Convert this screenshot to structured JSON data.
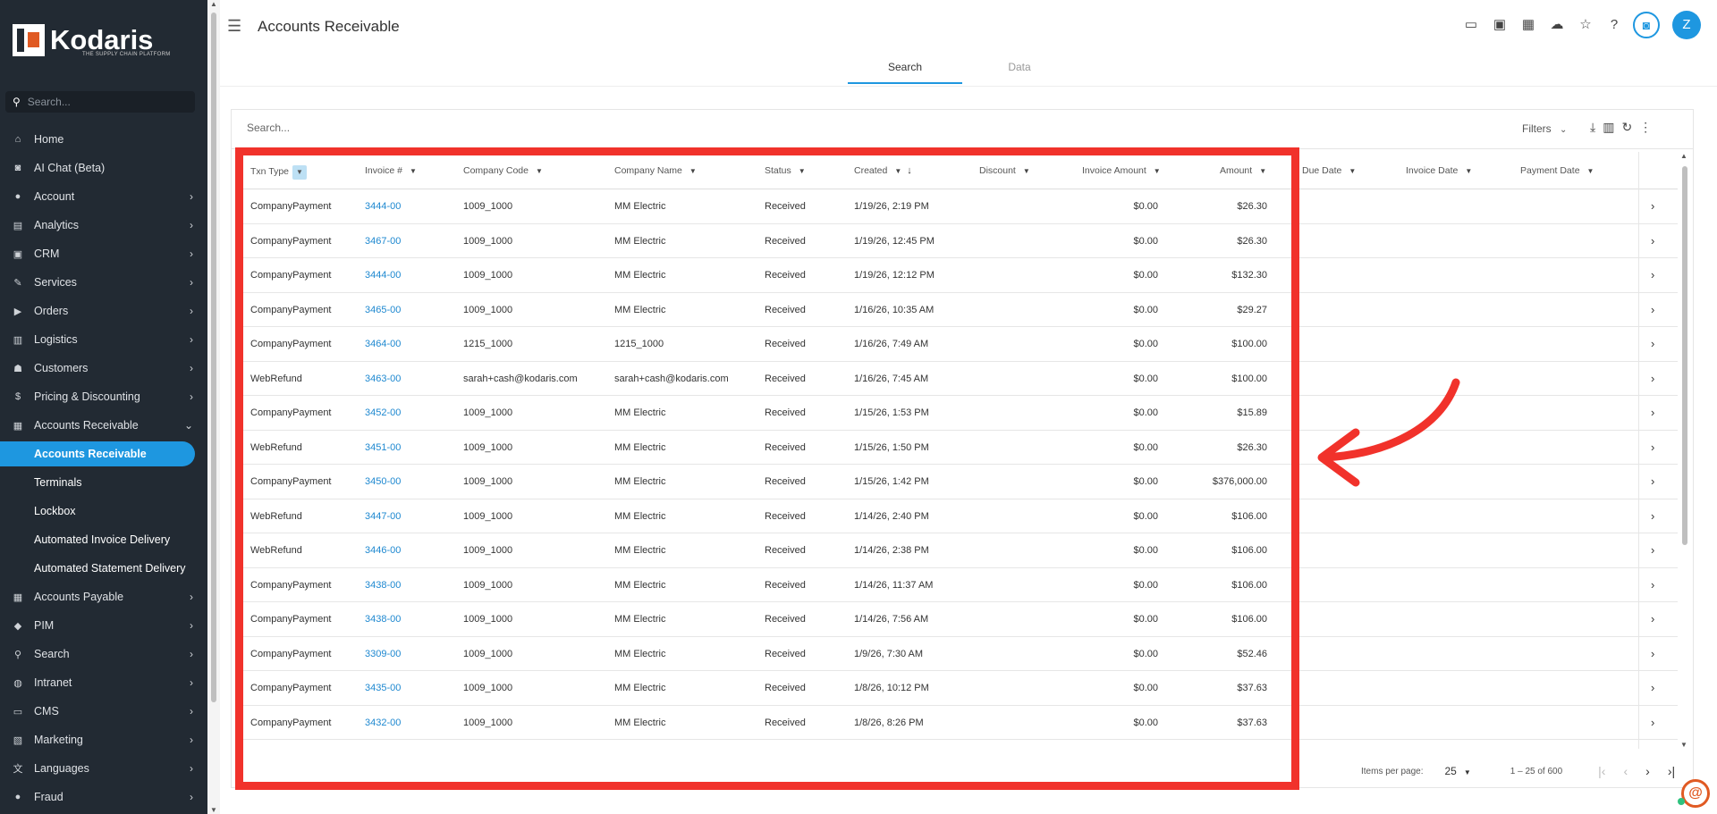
{
  "sidebar": {
    "brand": "Kodaris",
    "tagline": "THE SUPPLY CHAIN PLATFORM",
    "search_placeholder": "Search...",
    "items": [
      {
        "label": "Home",
        "icon": "home-icon",
        "glyph": "⌂"
      },
      {
        "label": "AI Chat (Beta)",
        "icon": "robot-icon",
        "glyph": "◙"
      },
      {
        "label": "Account",
        "icon": "person-icon",
        "glyph": "●"
      },
      {
        "label": "Analytics",
        "icon": "chart-icon",
        "glyph": "▤"
      },
      {
        "label": "CRM",
        "icon": "contact-card-icon",
        "glyph": "▣"
      },
      {
        "label": "Services",
        "icon": "services-icon",
        "glyph": "✎"
      },
      {
        "label": "Orders",
        "icon": "truck-icon",
        "glyph": "▶"
      },
      {
        "label": "Logistics",
        "icon": "box-icon",
        "glyph": "▥"
      },
      {
        "label": "Customers",
        "icon": "people-icon",
        "glyph": "☗"
      },
      {
        "label": "Pricing & Discounting",
        "icon": "dollar-icon",
        "glyph": "$"
      },
      {
        "label": "Accounts Receivable",
        "icon": "bank-icon",
        "glyph": "▦"
      }
    ],
    "sub_items": [
      {
        "label": "Accounts Receivable"
      },
      {
        "label": "Terminals"
      },
      {
        "label": "Lockbox"
      },
      {
        "label": "Automated Invoice Delivery"
      },
      {
        "label": "Automated Statement Delivery"
      }
    ],
    "items_after": [
      {
        "label": "Accounts Payable",
        "icon": "bank-icon",
        "glyph": "▦"
      },
      {
        "label": "PIM",
        "icon": "tag-icon",
        "glyph": "◆"
      },
      {
        "label": "Search",
        "icon": "search-icon",
        "glyph": "⚲"
      },
      {
        "label": "Intranet",
        "icon": "globe-icon",
        "glyph": "◍"
      },
      {
        "label": "CMS",
        "icon": "window-icon",
        "glyph": "▭"
      },
      {
        "label": "Marketing",
        "icon": "newspaper-icon",
        "glyph": "▧"
      },
      {
        "label": "Languages",
        "icon": "translate-icon",
        "glyph": "文"
      },
      {
        "label": "Fraud",
        "icon": "alert-icon",
        "glyph": "●"
      }
    ]
  },
  "header": {
    "title": "Accounts Receivable",
    "user_initial": "Z"
  },
  "tabs": [
    {
      "label": "Search"
    },
    {
      "label": "Data"
    }
  ],
  "table": {
    "search_placeholder": "Search...",
    "filters_label": "Filters",
    "columns": {
      "txn_type": "Txn Type",
      "invoice": "Invoice #",
      "company_code": "Company Code",
      "company_name": "Company Name",
      "status": "Status",
      "created": "Created",
      "discount": "Discount",
      "invoice_amount": "Invoice Amount",
      "amount": "Amount",
      "due_date": "Due Date",
      "invoice_date": "Invoice Date",
      "payment_date": "Payment Date"
    },
    "rows": [
      {
        "txn": "CompanyPayment",
        "inv": "3444-00",
        "code": "1009_1000",
        "name": "MM Electric",
        "status": "Received",
        "created": "1/19/26, 2:19 PM",
        "inv_amt": "$0.00",
        "amt": "$26.30"
      },
      {
        "txn": "CompanyPayment",
        "inv": "3467-00",
        "code": "1009_1000",
        "name": "MM Electric",
        "status": "Received",
        "created": "1/19/26, 12:45 PM",
        "inv_amt": "$0.00",
        "amt": "$26.30"
      },
      {
        "txn": "CompanyPayment",
        "inv": "3444-00",
        "code": "1009_1000",
        "name": "MM Electric",
        "status": "Received",
        "created": "1/19/26, 12:12 PM",
        "inv_amt": "$0.00",
        "amt": "$132.30"
      },
      {
        "txn": "CompanyPayment",
        "inv": "3465-00",
        "code": "1009_1000",
        "name": "MM Electric",
        "status": "Received",
        "created": "1/16/26, 10:35 AM",
        "inv_amt": "$0.00",
        "amt": "$29.27"
      },
      {
        "txn": "CompanyPayment",
        "inv": "3464-00",
        "code": "1215_1000",
        "name": "1215_1000",
        "status": "Received",
        "created": "1/16/26, 7:49 AM",
        "inv_amt": "$0.00",
        "amt": "$100.00"
      },
      {
        "txn": "WebRefund",
        "inv": "3463-00",
        "code": "sarah+cash@kodaris.com",
        "name": "sarah+cash@kodaris.com",
        "status": "Received",
        "created": "1/16/26, 7:45 AM",
        "inv_amt": "$0.00",
        "amt": "$100.00"
      },
      {
        "txn": "CompanyPayment",
        "inv": "3452-00",
        "code": "1009_1000",
        "name": "MM Electric",
        "status": "Received",
        "created": "1/15/26, 1:53 PM",
        "inv_amt": "$0.00",
        "amt": "$15.89"
      },
      {
        "txn": "WebRefund",
        "inv": "3451-00",
        "code": "1009_1000",
        "name": "MM Electric",
        "status": "Received",
        "created": "1/15/26, 1:50 PM",
        "inv_amt": "$0.00",
        "amt": "$26.30"
      },
      {
        "txn": "CompanyPayment",
        "inv": "3450-00",
        "code": "1009_1000",
        "name": "MM Electric",
        "status": "Received",
        "created": "1/15/26, 1:42 PM",
        "inv_amt": "$0.00",
        "amt": "$376,000.00"
      },
      {
        "txn": "WebRefund",
        "inv": "3447-00",
        "code": "1009_1000",
        "name": "MM Electric",
        "status": "Received",
        "created": "1/14/26, 2:40 PM",
        "inv_amt": "$0.00",
        "amt": "$106.00"
      },
      {
        "txn": "WebRefund",
        "inv": "3446-00",
        "code": "1009_1000",
        "name": "MM Electric",
        "status": "Received",
        "created": "1/14/26, 2:38 PM",
        "inv_amt": "$0.00",
        "amt": "$106.00"
      },
      {
        "txn": "CompanyPayment",
        "inv": "3438-00",
        "code": "1009_1000",
        "name": "MM Electric",
        "status": "Received",
        "created": "1/14/26, 11:37 AM",
        "inv_amt": "$0.00",
        "amt": "$106.00"
      },
      {
        "txn": "CompanyPayment",
        "inv": "3438-00",
        "code": "1009_1000",
        "name": "MM Electric",
        "status": "Received",
        "created": "1/14/26, 7:56 AM",
        "inv_amt": "$0.00",
        "amt": "$106.00"
      },
      {
        "txn": "CompanyPayment",
        "inv": "3309-00",
        "code": "1009_1000",
        "name": "MM Electric",
        "status": "Received",
        "created": "1/9/26, 7:30 AM",
        "inv_amt": "$0.00",
        "amt": "$52.46"
      },
      {
        "txn": "CompanyPayment",
        "inv": "3435-00",
        "code": "1009_1000",
        "name": "MM Electric",
        "status": "Received",
        "created": "1/8/26, 10:12 PM",
        "inv_amt": "$0.00",
        "amt": "$37.63"
      },
      {
        "txn": "CompanyPayment",
        "inv": "3432-00",
        "code": "1009_1000",
        "name": "MM Electric",
        "status": "Received",
        "created": "1/8/26, 8:26 PM",
        "inv_amt": "$0.00",
        "amt": "$37.63"
      }
    ]
  },
  "pager": {
    "items_per_page_label": "Items per page:",
    "page_size": "25",
    "range": "1 – 25 of 600"
  },
  "colors": {
    "accent": "#1e97e0",
    "highlight": "#f1322b",
    "sidebar_bg": "#222a33"
  }
}
